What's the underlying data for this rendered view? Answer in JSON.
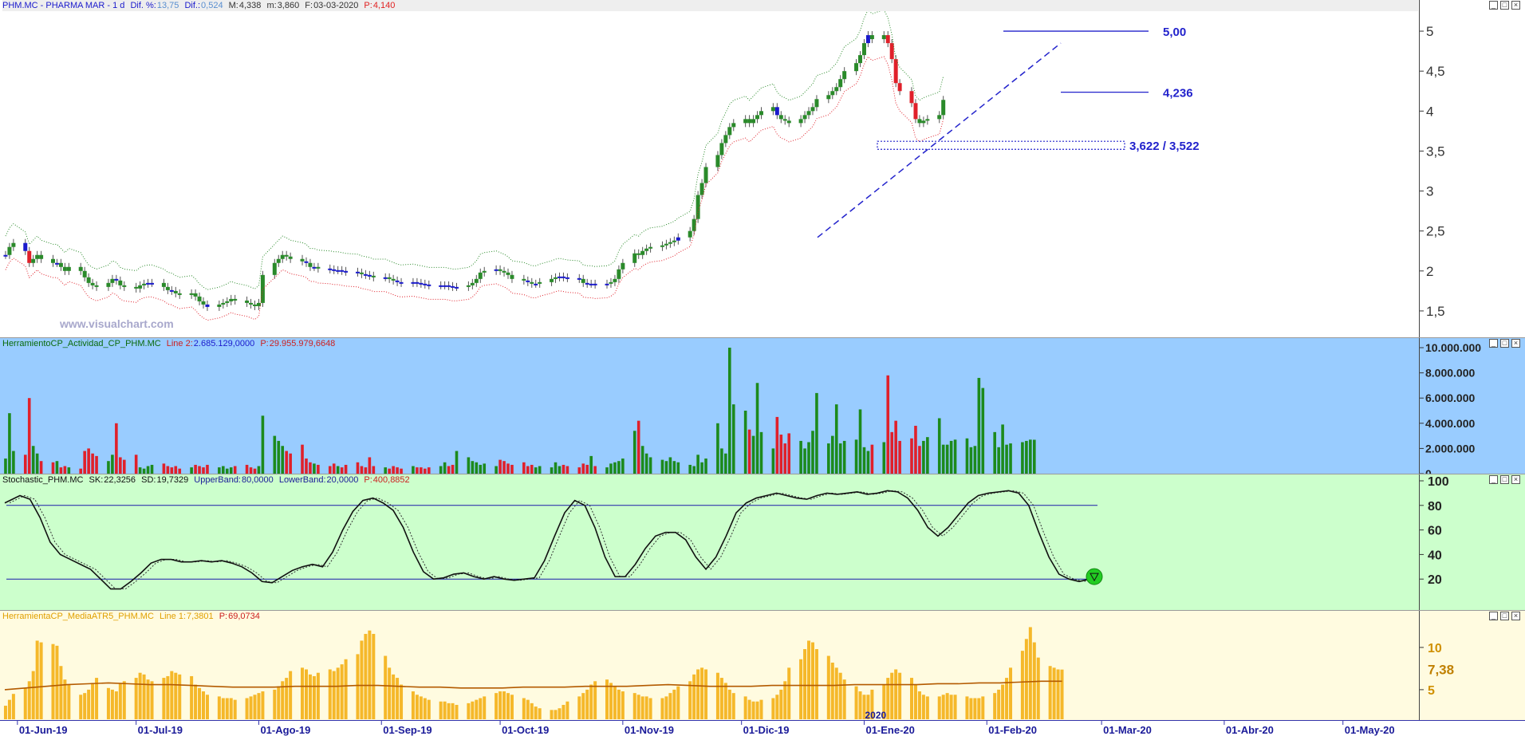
{
  "panes": {
    "price": {
      "title": "PHM.MC - PHARMA MAR -  1 d",
      "dif_label": "Dif. %:",
      "dif_pct": "13,75",
      "dif_abs_label": "Dif.:",
      "dif_abs": "0,524",
      "max_label": "M:",
      "max": "4,338",
      "min_label": "m:",
      "min": "3,860",
      "date_label": "F:",
      "date": "03-03-2020",
      "close_label": "P:",
      "close": "4,140",
      "watermark": "www.visualchart.com",
      "annotations": {
        "level_5": "5,00",
        "level_4236": "4,236",
        "level_zone": "3,622 / 3,522"
      }
    },
    "volume": {
      "title": "HerramientoCP_Actividad_CP_PHM.MC",
      "line_label": "Line 2:",
      "line_value": "2.685.129,0000",
      "p_label": "P:",
      "p_value": "29.955.979,6648"
    },
    "stochastic": {
      "title": "Stochastic_PHM.MC",
      "sk_label": "SK:",
      "sk": "22,3256",
      "sd_label": "SD:",
      "sd": "19,7329",
      "ub_label": "UpperBand:",
      "ub": "80,0000",
      "lb_label": "LowerBand:",
      "lb": "20,0000",
      "p_label": "P:",
      "p": "400,8852"
    },
    "atr": {
      "title": "HerramientaCP_MediaATR5_PHM.MC",
      "line_label": "Line 1:",
      "line_value": "7,3801",
      "p_label": "P:",
      "p_value": "69,0734",
      "last_marker": "7,38"
    }
  },
  "window_buttons": [
    "_",
    "□",
    "×"
  ],
  "x_axis": {
    "labels": [
      "01-Jun-19",
      "01-Jul-19",
      "01-Ago-19",
      "01-Sep-19",
      "01-Oct-19",
      "01-Nov-19",
      "01-Dic-19",
      "01-Ene-20",
      "01-Feb-20",
      "01-Mar-20",
      "01-Abr-20",
      "01-May-20"
    ],
    "year_marker": "2020"
  },
  "colors": {
    "price_bg": "#ffffff",
    "volume_bg": "#99ccff",
    "stoch_bg": "#ccffcc",
    "atr_bg": "#fffbe0",
    "up": "#2a8a2a",
    "down": "#e0202a",
    "neutral": "#1a1acc",
    "band_up": "#2a8a2a",
    "band_down": "#e0202a",
    "annotation": "#2222cc",
    "atr_bar": "#f5b82a",
    "atr_line": "#b35a00"
  },
  "chart_data": [
    {
      "type": "candlestick",
      "title": "PHM.MC - PHARMA MAR -  1 d",
      "ylim": [
        1.2,
        5.25
      ],
      "y_ticks": [
        "5",
        "4,5",
        "4",
        "3,5",
        "3",
        "2,5",
        "2",
        "1,5"
      ],
      "x_range": [
        "2019-05-28",
        "2020-05-20"
      ],
      "close": [
        2.2,
        2.3,
        2.35,
        2.25,
        2.1,
        2.15,
        2.2,
        2.15,
        2.1,
        2.1,
        2.05,
        2.0,
        2.05,
        2.0,
        1.92,
        1.85,
        1.82,
        1.8,
        1.85,
        1.9,
        1.88,
        1.82,
        1.8,
        1.78,
        1.82,
        1.84,
        1.85,
        1.85,
        1.8,
        1.76,
        1.75,
        1.72,
        1.7,
        1.72,
        1.68,
        1.62,
        1.58,
        1.55,
        1.58,
        1.6,
        1.62,
        1.65,
        1.63,
        1.6,
        1.58,
        1.56,
        1.6,
        1.95,
        2.1,
        2.15,
        2.2,
        2.18,
        2.15,
        2.12,
        2.1,
        2.05,
        2.05,
        2.03,
        2.02,
        2.01,
        2.01,
        2.0,
        1.99,
        1.98,
        1.96,
        1.95,
        1.94,
        1.92,
        1.92,
        1.9,
        1.88,
        1.86,
        1.85,
        1.86,
        1.85,
        1.84,
        1.83,
        1.82,
        1.82,
        1.82,
        1.81,
        1.8,
        1.8,
        1.82,
        1.85,
        1.9,
        1.98,
        2.0,
        2.02,
        2.0,
        1.98,
        1.95,
        1.9,
        1.88,
        1.86,
        1.84,
        1.84,
        1.86,
        1.9,
        1.92,
        1.93,
        1.92,
        1.91,
        1.9,
        1.85,
        1.84,
        1.84,
        1.83,
        1.84,
        1.86,
        1.9,
        2.02,
        2.1,
        2.22,
        2.2,
        2.25,
        2.28,
        2.3,
        2.32,
        2.34,
        2.36,
        2.38,
        2.42,
        2.5,
        2.65,
        2.95,
        3.1,
        3.3,
        3.45,
        3.6,
        3.7,
        3.8,
        3.85,
        3.9,
        3.85,
        3.9,
        3.95,
        4.0,
        4.05,
        3.95,
        3.9,
        3.88,
        3.85,
        3.9,
        3.95,
        4.0,
        4.05,
        4.15,
        4.2,
        4.25,
        4.3,
        4.4,
        4.5,
        4.6,
        4.7,
        4.85,
        4.95,
        4.9,
        4.95,
        4.85,
        4.65,
        4.35,
        4.25,
        4.1,
        3.9,
        3.85,
        3.88,
        3.9,
        3.95,
        4.14
      ],
      "bands": {
        "upper_offset": 0.12,
        "lower_offset": -0.12
      },
      "annotations": [
        {
          "label": "5,00",
          "y": 5.0
        },
        {
          "label": "4,236",
          "y": 4.236
        },
        {
          "label": "3,622 / 3,522",
          "y": [
            3.622,
            3.522
          ]
        }
      ]
    },
    {
      "type": "bar",
      "title": "HerramientoCP_Actividad_CP_PHM.MC",
      "ylim": [
        0,
        10000000
      ],
      "y_ticks": [
        "10.000.000",
        "8.000.000",
        "6.000.000",
        "4.000.000",
        "2.000.000",
        "0"
      ],
      "values_millions": [
        1.2,
        4.8,
        1.8,
        1.5,
        6.0,
        2.2,
        1.6,
        1.0,
        0.9,
        1.0,
        0.5,
        0.6,
        0.5,
        0.4,
        1.8,
        2.0,
        1.6,
        1.4,
        1.0,
        1.5,
        4.0,
        1.3,
        1.1,
        1.5,
        0.5,
        0.4,
        0.6,
        0.7,
        0.8,
        0.6,
        0.5,
        0.6,
        0.4,
        0.5,
        0.7,
        0.6,
        0.5,
        0.7,
        0.5,
        0.6,
        0.4,
        0.5,
        0.6,
        0.7,
        0.5,
        0.4,
        0.6,
        4.6,
        3.0,
        2.6,
        2.2,
        1.8,
        1.6,
        2.3,
        1.2,
        0.9,
        0.8,
        0.7,
        0.6,
        0.8,
        0.6,
        0.5,
        0.7,
        0.9,
        0.6,
        0.5,
        1.3,
        0.6,
        0.5,
        0.4,
        0.6,
        0.5,
        0.4,
        0.6,
        0.5,
        0.5,
        0.4,
        0.5,
        0.6,
        0.9,
        0.6,
        0.7,
        1.8,
        1.3,
        1.0,
        0.9,
        0.7,
        0.8,
        0.6,
        1.1,
        1.0,
        0.8,
        0.7,
        0.9,
        0.6,
        0.7,
        0.5,
        0.6,
        0.5,
        0.9,
        0.6,
        0.7,
        0.6,
        0.5,
        0.8,
        0.7,
        1.4,
        0.6,
        0.5,
        0.8,
        0.9,
        1.0,
        1.2,
        3.4,
        4.2,
        2.2,
        1.6,
        1.3,
        1.1,
        1.0,
        1.3,
        1.0,
        0.9,
        0.7,
        0.6,
        1.5,
        0.9,
        1.2,
        4.0,
        2.0,
        1.6,
        10.0,
        5.5,
        5.0,
        3.5,
        3.0,
        7.2,
        3.3,
        2.0,
        4.5,
        3.1,
        2.4,
        3.2,
        2.6,
        2.0,
        2.5,
        3.4,
        6.4,
        2.4,
        3.0,
        5.5,
        2.4,
        2.6,
        2.7,
        5.1,
        2.1,
        1.8,
        2.3,
        2.5,
        7.8,
        3.3,
        4.2,
        2.6,
        2.8,
        3.8,
        2.2,
        2.6,
        2.9,
        4.4,
        2.3,
        2.3,
        2.6,
        2.7,
        2.8,
        2.1,
        2.2,
        7.6,
        6.8,
        3.3,
        2.1,
        3.9,
        2.3,
        2.4,
        2.5,
        2.6,
        2.7,
        2.69
      ]
    },
    {
      "type": "line",
      "title": "Stochastic_PHM.MC",
      "ylim": [
        0,
        100
      ],
      "y_ticks": [
        "100",
        "80",
        "60",
        "40",
        "20"
      ],
      "bands": [
        80,
        20
      ],
      "sk_points": [
        [
          0,
          82
        ],
        [
          6,
          88
        ],
        [
          10,
          85
        ],
        [
          14,
          70
        ],
        [
          18,
          50
        ],
        [
          22,
          40
        ],
        [
          26,
          36
        ],
        [
          30,
          32
        ],
        [
          34,
          28
        ],
        [
          38,
          20
        ],
        [
          42,
          12
        ],
        [
          46,
          12
        ],
        [
          50,
          18
        ],
        [
          54,
          25
        ],
        [
          58,
          33
        ],
        [
          62,
          36
        ],
        [
          66,
          36
        ],
        [
          70,
          34
        ],
        [
          74,
          34
        ],
        [
          78,
          35
        ],
        [
          82,
          34
        ],
        [
          86,
          35
        ],
        [
          90,
          33
        ],
        [
          94,
          30
        ],
        [
          98,
          25
        ],
        [
          102,
          18
        ],
        [
          106,
          17
        ],
        [
          110,
          22
        ],
        [
          114,
          27
        ],
        [
          118,
          30
        ],
        [
          122,
          32
        ],
        [
          126,
          30
        ],
        [
          130,
          42
        ],
        [
          134,
          60
        ],
        [
          138,
          75
        ],
        [
          142,
          84
        ],
        [
          146,
          86
        ],
        [
          150,
          82
        ],
        [
          154,
          76
        ],
        [
          158,
          62
        ],
        [
          162,
          42
        ],
        [
          166,
          26
        ],
        [
          170,
          20
        ],
        [
          174,
          21
        ],
        [
          178,
          24
        ],
        [
          182,
          25
        ],
        [
          186,
          22
        ],
        [
          190,
          20
        ],
        [
          194,
          22
        ],
        [
          198,
          20
        ],
        [
          202,
          19
        ],
        [
          206,
          20
        ],
        [
          210,
          21
        ],
        [
          214,
          35
        ],
        [
          218,
          55
        ],
        [
          222,
          74
        ],
        [
          226,
          84
        ],
        [
          230,
          80
        ],
        [
          234,
          62
        ],
        [
          238,
          38
        ],
        [
          242,
          22
        ],
        [
          246,
          22
        ],
        [
          250,
          32
        ],
        [
          254,
          45
        ],
        [
          258,
          55
        ],
        [
          262,
          58
        ],
        [
          266,
          58
        ],
        [
          270,
          52
        ],
        [
          274,
          38
        ],
        [
          278,
          28
        ],
        [
          282,
          38
        ],
        [
          286,
          55
        ],
        [
          290,
          74
        ],
        [
          294,
          82
        ],
        [
          298,
          86
        ],
        [
          302,
          88
        ],
        [
          306,
          90
        ],
        [
          310,
          88
        ],
        [
          314,
          86
        ],
        [
          318,
          85
        ],
        [
          322,
          88
        ],
        [
          326,
          90
        ],
        [
          330,
          89
        ],
        [
          334,
          90
        ],
        [
          338,
          91
        ],
        [
          342,
          89
        ],
        [
          346,
          90
        ],
        [
          350,
          92
        ],
        [
          354,
          91
        ],
        [
          358,
          86
        ],
        [
          362,
          76
        ],
        [
          366,
          62
        ],
        [
          370,
          55
        ],
        [
          374,
          62
        ],
        [
          378,
          72
        ],
        [
          382,
          82
        ],
        [
          386,
          88
        ],
        [
          390,
          90
        ],
        [
          394,
          91
        ],
        [
          398,
          92
        ],
        [
          402,
          90
        ],
        [
          406,
          80
        ],
        [
          410,
          58
        ],
        [
          414,
          38
        ],
        [
          418,
          24
        ],
        [
          422,
          20
        ],
        [
          426,
          18
        ],
        [
          430,
          20
        ],
        [
          432,
          22
        ]
      ]
    },
    {
      "type": "bar",
      "title": "HerramientaCP_MediaATR5_PHM.MC",
      "ylim": [
        1.5,
        13.2
      ],
      "y_ticks": [
        "10",
        "5"
      ],
      "last_value": "7,38",
      "values": [
        3.1,
        3.8,
        4.5,
        5.2,
        6.0,
        7.2,
        10.8,
        10.6,
        10.4,
        10.2,
        7.8,
        6.2,
        5.6,
        4.4,
        4.6,
        5.0,
        5.8,
        6.4,
        5.2,
        5.0,
        4.8,
        5.8,
        6.0,
        6.4,
        7.0,
        6.8,
        6.2,
        6.0,
        6.4,
        6.6,
        7.2,
        7.0,
        6.8,
        6.6,
        5.6,
        5.2,
        4.8,
        4.4,
        4.2,
        4.0,
        4.0,
        4.0,
        3.8,
        4.0,
        4.2,
        4.4,
        4.6,
        4.8,
        5.0,
        5.4,
        6.0,
        6.4,
        7.2,
        7.6,
        7.4,
        6.8,
        6.6,
        7.0,
        7.4,
        7.2,
        7.6,
        8.0,
        8.6,
        9.2,
        10.8,
        11.6,
        12.0,
        11.6,
        9.0,
        7.6,
        6.8,
        6.4,
        5.6,
        4.8,
        4.4,
        4.2,
        4.0,
        3.8,
        3.6,
        3.6,
        3.4,
        3.4,
        3.2,
        3.4,
        3.6,
        3.8,
        4.0,
        4.2,
        4.6,
        4.8,
        4.8,
        4.6,
        4.4,
        4.0,
        3.8,
        3.4,
        3.0,
        2.8,
        2.6,
        2.6,
        2.8,
        3.2,
        3.6,
        4.2,
        4.6,
        5.0,
        5.6,
        6.0,
        6.2,
        5.8,
        5.4,
        5.0,
        4.8,
        4.6,
        4.4,
        4.2,
        4.2,
        4.0,
        4.0,
        4.2,
        4.6,
        5.0,
        5.4,
        6.0,
        6.8,
        7.4,
        7.6,
        7.4,
        7.0,
        6.4,
        5.8,
        5.0,
        4.6,
        4.2,
        3.8,
        3.6,
        3.6,
        3.8,
        4.0,
        4.4,
        5.0,
        6.0,
        7.6,
        8.6,
        9.8,
        10.8,
        10.6,
        9.8,
        9.0,
        8.2,
        7.6,
        7.0,
        6.2,
        5.4,
        4.8,
        4.4,
        4.4,
        5.0,
        5.6,
        6.4,
        7.0,
        7.4,
        7.0,
        6.4,
        5.6,
        4.8,
        4.4,
        4.2,
        4.2,
        4.4,
        4.6,
        4.4,
        4.4,
        4.2,
        4.0,
        4.0,
        4.0,
        4.2,
        4.6,
        5.0,
        5.6,
        6.4,
        7.6,
        9.6,
        11.0,
        12.4,
        10.6,
        8.8,
        7.8,
        7.6,
        7.4,
        7.38
      ],
      "avg_line": [
        5.0,
        5.2,
        5.4,
        5.6,
        5.7,
        5.8,
        5.7,
        5.6,
        5.6,
        5.5,
        5.4,
        5.3,
        5.3,
        5.3,
        5.4,
        5.4,
        5.4,
        5.5,
        5.5,
        5.4,
        5.3,
        5.3,
        5.2,
        5.2,
        5.2,
        5.3,
        5.3,
        5.3,
        5.4,
        5.4,
        5.4,
        5.5,
        5.6,
        5.5,
        5.4,
        5.4,
        5.4,
        5.5,
        5.5,
        5.5,
        5.5,
        5.6,
        5.6,
        5.6,
        5.6,
        5.7,
        5.7,
        5.8,
        5.8,
        5.9,
        6.0,
        6.0
      ]
    }
  ]
}
